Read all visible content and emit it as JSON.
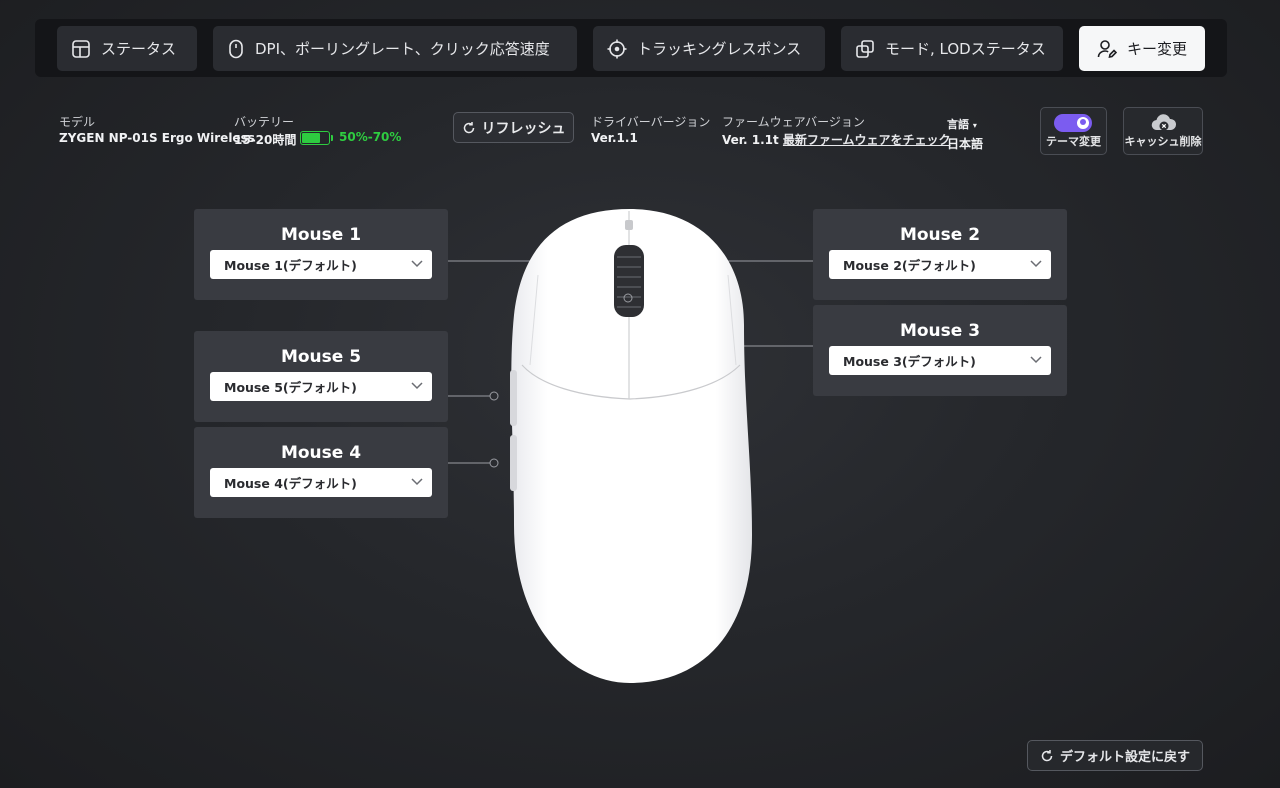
{
  "nav": {
    "tabs": [
      {
        "label": "ステータス",
        "icon": "layout-icon"
      },
      {
        "label": "DPI、ポーリングレート、クリック応答速度",
        "icon": "mouse-icon"
      },
      {
        "label": "トラッキングレスポンス",
        "icon": "crosshair-icon"
      },
      {
        "label": "モード, LODステータス",
        "icon": "copy-icon"
      },
      {
        "label": "キー変更",
        "icon": "user-edit-icon",
        "active": true
      }
    ]
  },
  "info": {
    "model_label": "モデル",
    "model_value": "ZYGEN NP-01S Ergo Wireless",
    "battery_label": "バッテリー",
    "battery_hours": "15-20時間",
    "battery_range": "50%-70%",
    "battery_color": "#2ecc40",
    "refresh_label": "リフレッシュ",
    "driver_label": "ドライバーバージョン",
    "driver_value": "Ver.1.1",
    "firmware_label": "ファームウェアバージョン",
    "firmware_value": "Ver. 1.1t",
    "firmware_link": "最新ファームウェアをチェック",
    "language_label": "言語",
    "language_value": "日本語",
    "theme_label": "テーマ変更",
    "theme_accent": "#7b5cf0",
    "cache_label": "キャッシュ削除"
  },
  "buttons": {
    "mouse1": {
      "title": "Mouse 1",
      "value": "Mouse 1(デフォルト)"
    },
    "mouse2": {
      "title": "Mouse 2",
      "value": "Mouse 2(デフォルト)"
    },
    "mouse3": {
      "title": "Mouse 3",
      "value": "Mouse 3(デフォルト)"
    },
    "mouse4": {
      "title": "Mouse 4",
      "value": "Mouse 4(デフォルト)"
    },
    "mouse5": {
      "title": "Mouse 5",
      "value": "Mouse 5(デフォルト)"
    }
  },
  "reset_label": "デフォルト設定に戻す"
}
